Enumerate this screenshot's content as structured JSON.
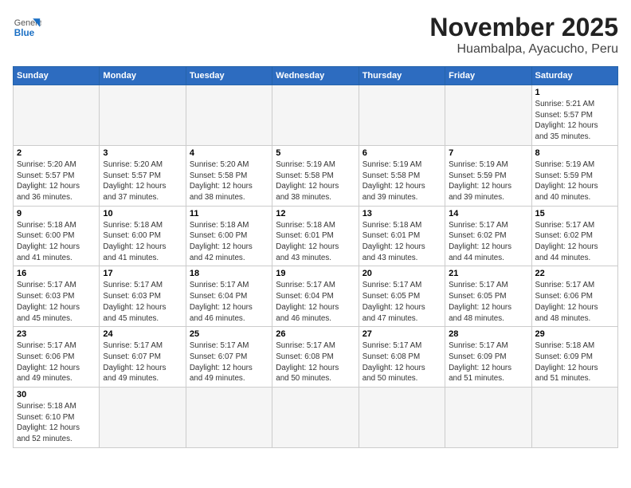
{
  "header": {
    "logo_general": "General",
    "logo_blue": "Blue",
    "title": "November 2025",
    "subtitle": "Huambalpa, Ayacucho, Peru"
  },
  "calendar": {
    "days_of_week": [
      "Sunday",
      "Monday",
      "Tuesday",
      "Wednesday",
      "Thursday",
      "Friday",
      "Saturday"
    ],
    "weeks": [
      [
        {
          "day": "",
          "info": ""
        },
        {
          "day": "",
          "info": ""
        },
        {
          "day": "",
          "info": ""
        },
        {
          "day": "",
          "info": ""
        },
        {
          "day": "",
          "info": ""
        },
        {
          "day": "",
          "info": ""
        },
        {
          "day": "1",
          "info": "Sunrise: 5:21 AM\nSunset: 5:57 PM\nDaylight: 12 hours\nand 35 minutes."
        }
      ],
      [
        {
          "day": "2",
          "info": "Sunrise: 5:20 AM\nSunset: 5:57 PM\nDaylight: 12 hours\nand 36 minutes."
        },
        {
          "day": "3",
          "info": "Sunrise: 5:20 AM\nSunset: 5:57 PM\nDaylight: 12 hours\nand 37 minutes."
        },
        {
          "day": "4",
          "info": "Sunrise: 5:20 AM\nSunset: 5:58 PM\nDaylight: 12 hours\nand 38 minutes."
        },
        {
          "day": "5",
          "info": "Sunrise: 5:19 AM\nSunset: 5:58 PM\nDaylight: 12 hours\nand 38 minutes."
        },
        {
          "day": "6",
          "info": "Sunrise: 5:19 AM\nSunset: 5:58 PM\nDaylight: 12 hours\nand 39 minutes."
        },
        {
          "day": "7",
          "info": "Sunrise: 5:19 AM\nSunset: 5:59 PM\nDaylight: 12 hours\nand 39 minutes."
        },
        {
          "day": "8",
          "info": "Sunrise: 5:19 AM\nSunset: 5:59 PM\nDaylight: 12 hours\nand 40 minutes."
        }
      ],
      [
        {
          "day": "9",
          "info": "Sunrise: 5:18 AM\nSunset: 6:00 PM\nDaylight: 12 hours\nand 41 minutes."
        },
        {
          "day": "10",
          "info": "Sunrise: 5:18 AM\nSunset: 6:00 PM\nDaylight: 12 hours\nand 41 minutes."
        },
        {
          "day": "11",
          "info": "Sunrise: 5:18 AM\nSunset: 6:00 PM\nDaylight: 12 hours\nand 42 minutes."
        },
        {
          "day": "12",
          "info": "Sunrise: 5:18 AM\nSunset: 6:01 PM\nDaylight: 12 hours\nand 43 minutes."
        },
        {
          "day": "13",
          "info": "Sunrise: 5:18 AM\nSunset: 6:01 PM\nDaylight: 12 hours\nand 43 minutes."
        },
        {
          "day": "14",
          "info": "Sunrise: 5:17 AM\nSunset: 6:02 PM\nDaylight: 12 hours\nand 44 minutes."
        },
        {
          "day": "15",
          "info": "Sunrise: 5:17 AM\nSunset: 6:02 PM\nDaylight: 12 hours\nand 44 minutes."
        }
      ],
      [
        {
          "day": "16",
          "info": "Sunrise: 5:17 AM\nSunset: 6:03 PM\nDaylight: 12 hours\nand 45 minutes."
        },
        {
          "day": "17",
          "info": "Sunrise: 5:17 AM\nSunset: 6:03 PM\nDaylight: 12 hours\nand 45 minutes."
        },
        {
          "day": "18",
          "info": "Sunrise: 5:17 AM\nSunset: 6:04 PM\nDaylight: 12 hours\nand 46 minutes."
        },
        {
          "day": "19",
          "info": "Sunrise: 5:17 AM\nSunset: 6:04 PM\nDaylight: 12 hours\nand 46 minutes."
        },
        {
          "day": "20",
          "info": "Sunrise: 5:17 AM\nSunset: 6:05 PM\nDaylight: 12 hours\nand 47 minutes."
        },
        {
          "day": "21",
          "info": "Sunrise: 5:17 AM\nSunset: 6:05 PM\nDaylight: 12 hours\nand 48 minutes."
        },
        {
          "day": "22",
          "info": "Sunrise: 5:17 AM\nSunset: 6:06 PM\nDaylight: 12 hours\nand 48 minutes."
        }
      ],
      [
        {
          "day": "23",
          "info": "Sunrise: 5:17 AM\nSunset: 6:06 PM\nDaylight: 12 hours\nand 49 minutes."
        },
        {
          "day": "24",
          "info": "Sunrise: 5:17 AM\nSunset: 6:07 PM\nDaylight: 12 hours\nand 49 minutes."
        },
        {
          "day": "25",
          "info": "Sunrise: 5:17 AM\nSunset: 6:07 PM\nDaylight: 12 hours\nand 49 minutes."
        },
        {
          "day": "26",
          "info": "Sunrise: 5:17 AM\nSunset: 6:08 PM\nDaylight: 12 hours\nand 50 minutes."
        },
        {
          "day": "27",
          "info": "Sunrise: 5:17 AM\nSunset: 6:08 PM\nDaylight: 12 hours\nand 50 minutes."
        },
        {
          "day": "28",
          "info": "Sunrise: 5:17 AM\nSunset: 6:09 PM\nDaylight: 12 hours\nand 51 minutes."
        },
        {
          "day": "29",
          "info": "Sunrise: 5:18 AM\nSunset: 6:09 PM\nDaylight: 12 hours\nand 51 minutes."
        }
      ],
      [
        {
          "day": "30",
          "info": "Sunrise: 5:18 AM\nSunset: 6:10 PM\nDaylight: 12 hours\nand 52 minutes."
        },
        {
          "day": "",
          "info": ""
        },
        {
          "day": "",
          "info": ""
        },
        {
          "day": "",
          "info": ""
        },
        {
          "day": "",
          "info": ""
        },
        {
          "day": "",
          "info": ""
        },
        {
          "day": "",
          "info": ""
        }
      ]
    ]
  }
}
